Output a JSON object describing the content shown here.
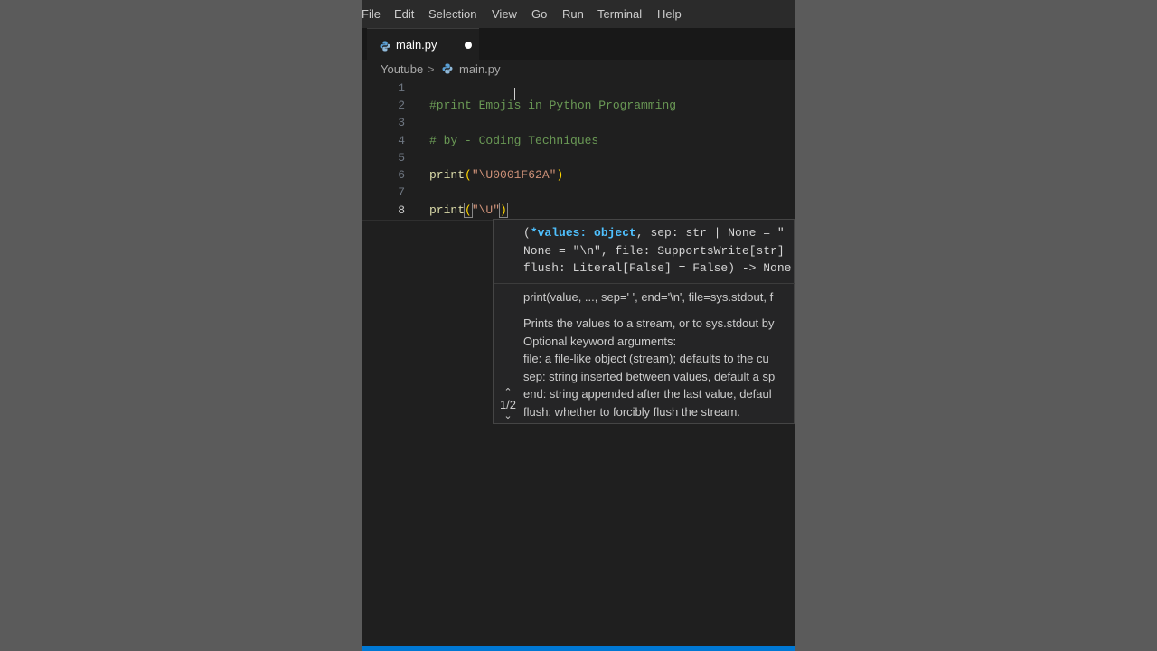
{
  "menu": [
    "File",
    "Edit",
    "Selection",
    "View",
    "Go",
    "Run",
    "Terminal",
    "Help"
  ],
  "tab": {
    "label": "main.py",
    "icon": "python-file-icon"
  },
  "breadcrumb": {
    "folder": "Youtube",
    "separator": ">",
    "file": "main.py"
  },
  "code_lines": {
    "n1": "1",
    "n2": "2",
    "n3": "3",
    "n4": "4",
    "n5": "5",
    "n6": "6",
    "n7": "7",
    "n8": "8",
    "l2": "#print Emojis in Python Programming",
    "l4": "# by - Coding Techniques",
    "l6_fn": "print",
    "l6_open": "(",
    "l6_str": "\"\\U0001F62A\"",
    "l6_close": ")",
    "l8_fn": "print",
    "l8_open": "(",
    "l8_str": "\"\\U\"",
    "l8_close": ")"
  },
  "hover": {
    "sig_open": "(",
    "sig_param": "*values: object",
    "sig_rest1": ", sep: str | None = \"",
    "sig_line2": "None = \"\\n\", file: SupportsWrite[str]",
    "sig_line3": "flush: Literal[False] = False) -> None",
    "doc_signature": "print(value, ..., sep=' ', end='\\n', file=sys.stdout, f",
    "doc_lines": [
      "Prints the values to a stream, or to sys.stdout by",
      "Optional keyword arguments:",
      "file: a file-like object (stream); defaults to the cu",
      "sep: string inserted between values, default a sp",
      "end: string appended after the last value, defaul",
      "flush: whether to forcibly flush the stream."
    ],
    "pager": "1/2"
  },
  "colors": {
    "editor_bg": "#1f1f1f",
    "comment": "#6a9955",
    "function": "#dcdcaa",
    "string": "#ce9178",
    "bracket": "#ffd700",
    "status_accent": "#0078d4"
  }
}
